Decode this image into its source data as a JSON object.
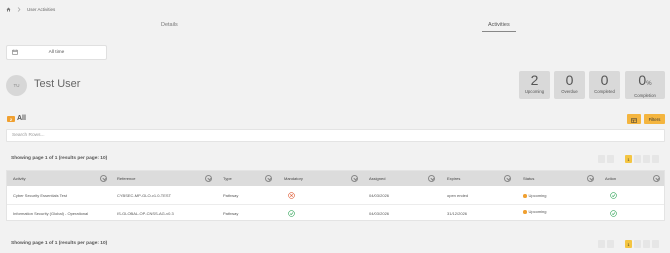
{
  "breadcrumb": {
    "home_icon": "home-icon",
    "separator_icon": "chevron-right-icon",
    "current": "User Activities"
  },
  "tabs": [
    {
      "label": "Details",
      "active": false
    },
    {
      "label": "Activities",
      "active": true
    }
  ],
  "date_filter": {
    "icon": "calendar-icon",
    "value": "All time"
  },
  "user": {
    "initials": "TU",
    "name": "Test User"
  },
  "stats": [
    {
      "value": "2",
      "suffix": "",
      "label": "Upcoming"
    },
    {
      "value": "0",
      "suffix": "",
      "label": "Overdue"
    },
    {
      "value": "0",
      "suffix": "",
      "label": "Completed"
    },
    {
      "value": "0",
      "suffix": "%",
      "label": "Completion"
    }
  ],
  "list": {
    "count": "2",
    "title": "All",
    "export_icon": "export-icon",
    "filters_label": "Filters",
    "search_placeholder": "Search Rows..."
  },
  "paging": {
    "showing_text": "Showing page 1 of 1 (results per page: 10)",
    "current_page": "1"
  },
  "table": {
    "columns": [
      "Activity",
      "Reference",
      "Type",
      "Mandatory",
      "Assigned",
      "Expires",
      "Status",
      "Action"
    ],
    "rows": [
      {
        "activity": "Cyber Security Essentials Test",
        "reference": "CYBSEC-MP-GLO-v1.0-TEST",
        "type": "Pathway",
        "mandatory": false,
        "assigned": "04/03/2026",
        "expires": "open ended",
        "status": "Upcoming"
      },
      {
        "activity": "Information Security (Global) - Operational",
        "reference": "IS-GLOBAL-OP-CNSS-AG-v0.3",
        "type": "Pathway",
        "mandatory": true,
        "assigned": "04/03/2026",
        "expires": "31/12/2026",
        "status": "Upcoming"
      }
    ]
  },
  "colors": {
    "accent": "#f4b53f",
    "status_upcoming": "#f0a030",
    "check": "#3aa85f",
    "cross": "#e0603a"
  }
}
